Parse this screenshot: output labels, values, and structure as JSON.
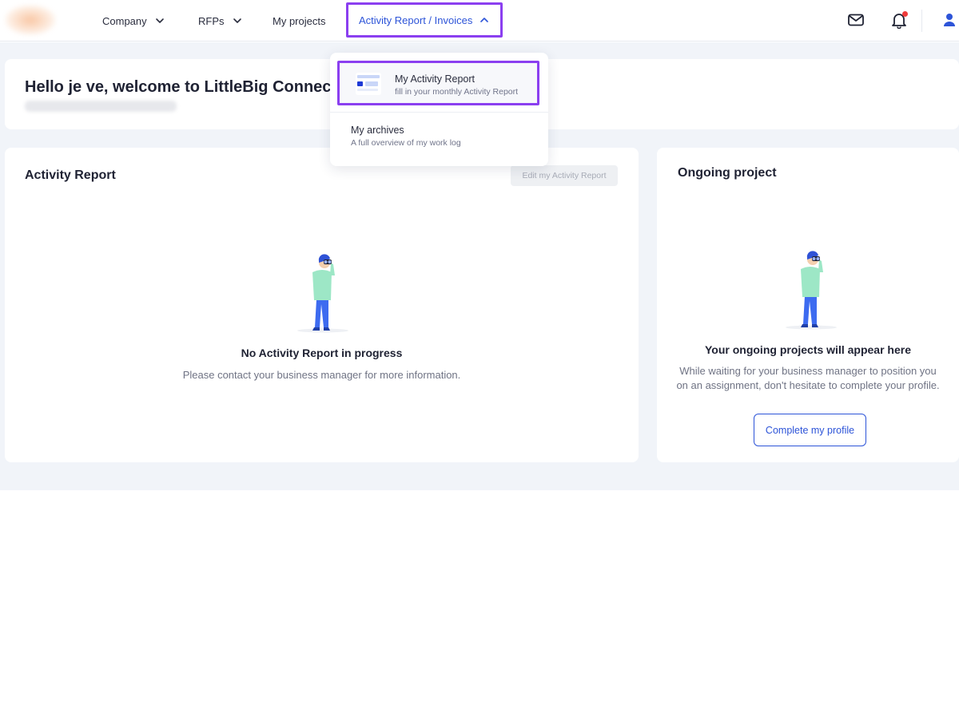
{
  "nav": {
    "items": [
      {
        "label": "Company",
        "has_chevron": true
      },
      {
        "label": "RFPs",
        "has_chevron": true
      },
      {
        "label": "My projects",
        "has_chevron": false
      },
      {
        "label": "Activity Report / Invoices",
        "has_chevron": true,
        "expanded": true
      }
    ],
    "icons": [
      "mail-icon",
      "bell-icon",
      "user-icon"
    ],
    "notification_dot": true
  },
  "dropdown": {
    "items": [
      {
        "label": "My Activity Report",
        "sub": "fill in your monthly Activity Report",
        "icon": "activity-report-thumbnail-icon"
      },
      {
        "label": "My archives",
        "sub": "A full overview of my work log"
      }
    ]
  },
  "welcome": {
    "title": "Hello je ve, welcome to LittleBig Connect"
  },
  "activity_card": {
    "title": "Activity Report",
    "edit_label": "Edit my Activity Report",
    "empty_title": "No Activity Report in progress",
    "empty_text": "Please contact your business manager for more information."
  },
  "ongoing_card": {
    "title": "Ongoing project",
    "empty_title": "Your ongoing projects will appear here",
    "empty_text": "While waiting for your business manager to position you on an assignment, don't hesitate to complete your profile.",
    "button_label": "Complete my profile"
  },
  "colors": {
    "accent": "#2d54d8",
    "highlight_border": "#8b3ff0",
    "page_background": "#f1f4f9",
    "notification": "#ef3b3b"
  }
}
